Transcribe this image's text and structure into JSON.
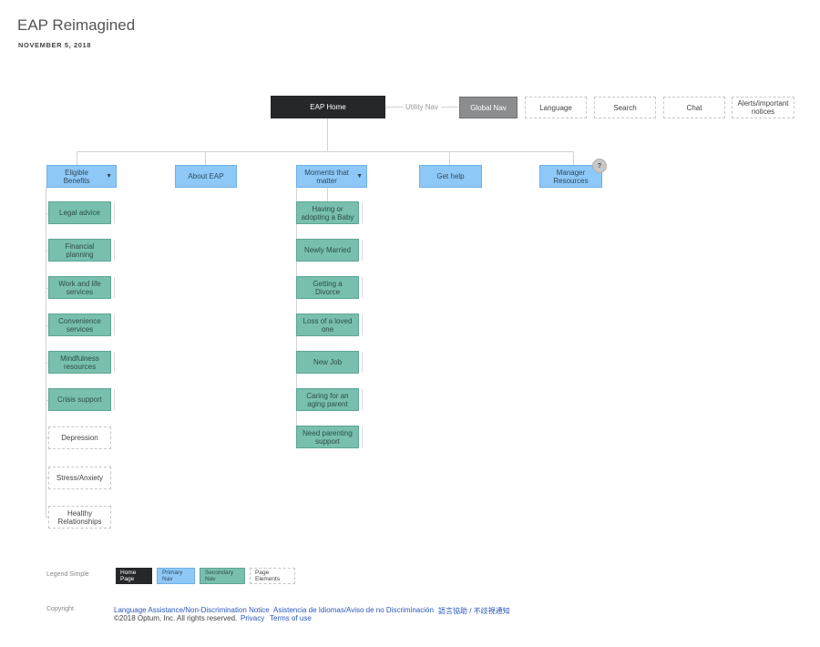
{
  "header": {
    "title": "EAP Reimagined",
    "date": "NOVEMBER 5, 2018"
  },
  "top": {
    "home": "EAP Home",
    "utility_nav_label": "Utility Nav",
    "global_nav": "Global Nav",
    "utility_items": [
      "Language",
      "Search",
      "Chat",
      "Alerts/important notices"
    ]
  },
  "primary": {
    "eligible_benefits": "Eligible Benefits",
    "about": "About EAP",
    "moments": "Moments that matter",
    "get_help": "Get help",
    "manager": "Manager Resources",
    "help_badge": "?"
  },
  "benefits_children": [
    "Legal advice",
    "Financial planning",
    "Work and life services",
    "Convenience services",
    "Mindfulness resources",
    "Crisis support"
  ],
  "crisis_pages": [
    "Depression",
    "Stress/Anxiety",
    "Healthy Relationships"
  ],
  "moments_children": [
    "Having or adopting a Baby",
    "Newly Married",
    "Getting a Divorce",
    "Loss of a loved one",
    "New Job",
    "Caring for an aging parent",
    "Need parenting support"
  ],
  "legend": {
    "label": "Legend Simple",
    "home": "Home Page",
    "primary": "Primary Nav",
    "secondary": "Secondary Nav",
    "page": "Page Elements"
  },
  "footer": {
    "label": "Copyright",
    "link1": "Language Assistance/Non-Discrimination Notice",
    "link2": "Asistencia de Idiomas/Aviso de no Discriminación",
    "link3": "語言協助 / 不歧視通知",
    "copyright": "©2018 Optum, Inc. All rights reserved.",
    "privacy": "Privacy",
    "terms": "Terms of use"
  },
  "colors": {
    "home": "#25272a",
    "primary": "#8ec8f7",
    "secondary": "#78bfae",
    "link": "#2a57b8"
  }
}
